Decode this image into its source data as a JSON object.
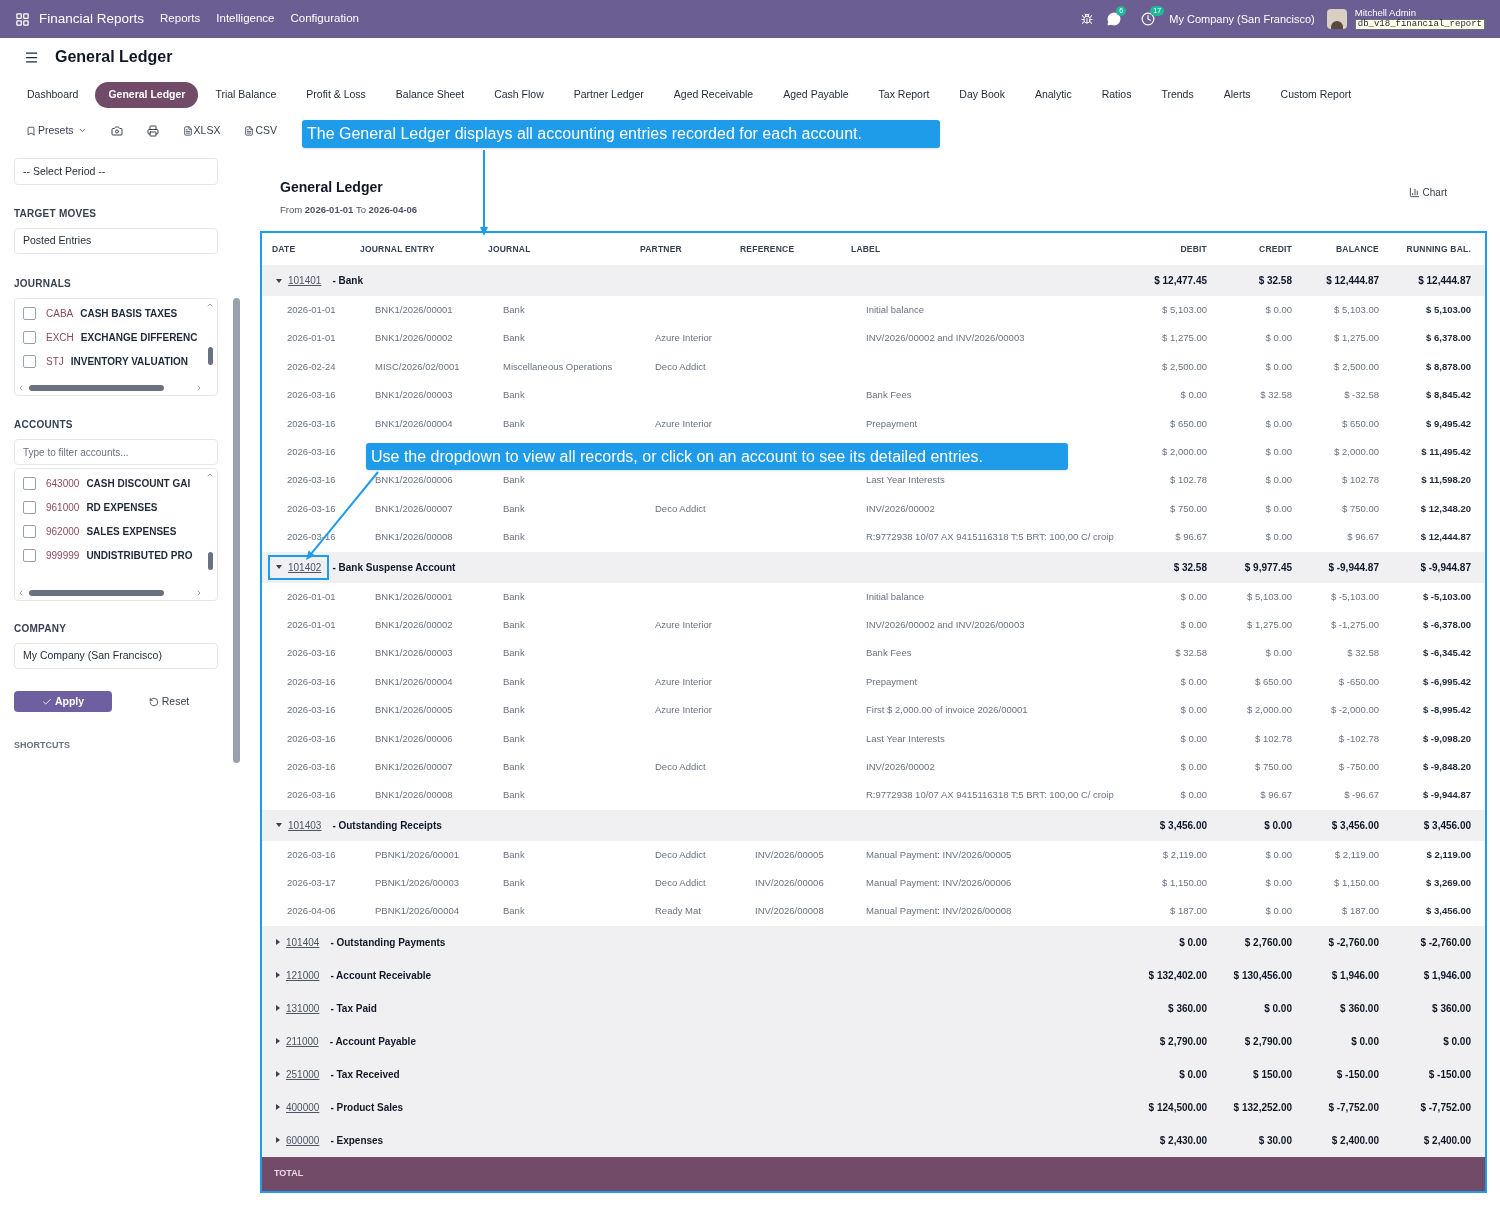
{
  "app": {
    "title": "Financial Reports",
    "menu": [
      "Reports",
      "Intelligence",
      "Configuration"
    ]
  },
  "systray": {
    "messages_badge": "6",
    "activities_badge": "17",
    "company": "My Company (San Francisco)",
    "user": "Mitchell Admin",
    "database": "db_v18_financial_report"
  },
  "page_title": "General Ledger",
  "tabs": [
    {
      "label": "Dashboard",
      "selected": false
    },
    {
      "label": "General Ledger",
      "selected": true
    },
    {
      "label": "Trial Balance",
      "selected": false
    },
    {
      "label": "Profit & Loss",
      "selected": false
    },
    {
      "label": "Balance Sheet",
      "selected": false
    },
    {
      "label": "Cash Flow",
      "selected": false
    },
    {
      "label": "Partner Ledger",
      "selected": false
    },
    {
      "label": "Aged Receivable",
      "selected": false
    },
    {
      "label": "Aged Payable",
      "selected": false
    },
    {
      "label": "Tax Report",
      "selected": false
    },
    {
      "label": "Day Book",
      "selected": false
    },
    {
      "label": "Analytic",
      "selected": false
    },
    {
      "label": "Ratios",
      "selected": false
    },
    {
      "label": "Trends",
      "selected": false
    },
    {
      "label": "Alerts",
      "selected": false
    },
    {
      "label": "Custom Report",
      "selected": false
    }
  ],
  "toolbar": {
    "presets": "Presets",
    "exports": [
      "XLSX",
      "CSV"
    ]
  },
  "sidebar": {
    "period": "-- Select Period --",
    "target_moves_label": "TARGET MOVES",
    "target_moves": "Posted Entries",
    "journals_label": "JOURNALS",
    "journals": [
      {
        "code": "CABA",
        "name": "CASH BASIS TAXES",
        "checked": false
      },
      {
        "code": "EXCH",
        "name": "EXCHANGE DIFFERENC",
        "checked": false
      },
      {
        "code": "STJ",
        "name": "INVENTORY VALUATION",
        "checked": false
      }
    ],
    "accounts_label": "ACCOUNTS",
    "accounts_placeholder": "Type to filter accounts...",
    "accounts": [
      {
        "code": "643000",
        "name": "CASH DISCOUNT GAI",
        "checked": false
      },
      {
        "code": "961000",
        "name": "RD EXPENSES",
        "checked": false
      },
      {
        "code": "962000",
        "name": "SALES EXPENSES",
        "checked": false
      },
      {
        "code": "999999",
        "name": "UNDISTRIBUTED PRO",
        "checked": false
      }
    ],
    "company_label": "COMPANY",
    "company": "My Company (San Francisco)",
    "apply": "Apply",
    "reset": "Reset",
    "shortcuts_label": "SHORTCUTS"
  },
  "report": {
    "title": "General Ledger",
    "period": "From **2026-01-01** To **2026-04-06**",
    "chart_button": "Chart",
    "columns": [
      "DATE",
      "JOURNAL ENTRY",
      "JOURNAL",
      "PARTNER",
      "REFERENCE",
      "LABEL",
      "DEBIT",
      "CREDIT",
      "BALANCE",
      "RUNNING BAL."
    ],
    "groups": [
      {
        "code": "101401",
        "name": "- Bank",
        "expanded": true,
        "highlighted": false,
        "debit": "$ 12,477.45",
        "credit": "$ 32.58",
        "balance": "$ 12,444.87",
        "running": "$ 12,444.87",
        "lines": [
          {
            "date": "2026-01-01",
            "entry": "BNK1/2026/00001",
            "journal": "Bank",
            "label": "Initial balance",
            "debit": "$ 5,103.00",
            "credit": "$ 0.00",
            "balance": "$ 5,103.00",
            "running": "$ 5,103.00"
          },
          {
            "date": "2026-01-01",
            "entry": "BNK1/2026/00002",
            "journal": "Bank",
            "partner": "Azure Interior",
            "label": "INV/2026/00002 and INV/2026/00003",
            "debit": "$ 1,275.00",
            "credit": "$ 0.00",
            "balance": "$ 1,275.00",
            "running": "$ 6,378.00"
          },
          {
            "date": "2026-02-24",
            "entry": "MISC/2026/02/0001",
            "journal": "Miscellaneous Operations",
            "partner": "Deco Addict",
            "debit": "$ 2,500.00",
            "credit": "$ 0.00",
            "balance": "$ 2,500.00",
            "running": "$ 8,878.00"
          },
          {
            "date": "2026-03-16",
            "entry": "BNK1/2026/00003",
            "journal": "Bank",
            "label": "Bank Fees",
            "debit": "$ 0.00",
            "credit": "$ 32.58",
            "balance": "$ -32.58",
            "running": "$ 8,845.42"
          },
          {
            "date": "2026-03-16",
            "entry": "BNK1/2026/00004",
            "journal": "Bank",
            "partner": "Azure Interior",
            "label": "Prepayment",
            "debit": "$ 650.00",
            "credit": "$ 0.00",
            "balance": "$ 650.00",
            "running": "$ 9,495.42"
          },
          {
            "date": "2026-03-16",
            "debit": "$ 2,000.00",
            "credit": "$ 0.00",
            "balance": "$ 2,000.00",
            "running": "$ 11,495.42"
          },
          {
            "date": "2026-03-16",
            "entry": "BNK1/2026/00006",
            "journal": "Bank",
            "label": "Last Year Interests",
            "debit": "$ 102.78",
            "credit": "$ 0.00",
            "balance": "$ 102.78",
            "running": "$ 11,598.20"
          },
          {
            "date": "2026-03-16",
            "entry": "BNK1/2026/00007",
            "journal": "Bank",
            "partner": "Deco Addict",
            "label": "INV/2026/00002",
            "debit": "$ 750.00",
            "credit": "$ 0.00",
            "balance": "$ 750.00",
            "running": "$ 12,348.20"
          },
          {
            "date": "2026-03-16",
            "entry": "BNK1/2026/00008",
            "journal": "Bank",
            "label": "R:9772938 10/07 AX 9415116318 T:5 BRT: 100,00 C/ croip",
            "debit": "$ 96.67",
            "credit": "$ 0.00",
            "balance": "$ 96.67",
            "running": "$ 12,444.87"
          }
        ]
      },
      {
        "code": "101402",
        "name": "- Bank Suspense Account",
        "expanded": true,
        "highlighted": true,
        "debit": "$ 32.58",
        "credit": "$ 9,977.45",
        "balance": "$ -9,944.87",
        "running": "$ -9,944.87",
        "lines": [
          {
            "date": "2026-01-01",
            "entry": "BNK1/2026/00001",
            "journal": "Bank",
            "label": "Initial balance",
            "debit": "$ 0.00",
            "credit": "$ 5,103.00",
            "balance": "$ -5,103.00",
            "running": "$ -5,103.00"
          },
          {
            "date": "2026-01-01",
            "entry": "BNK1/2026/00002",
            "journal": "Bank",
            "partner": "Azure Interior",
            "label": "INV/2026/00002 and INV/2026/00003",
            "debit": "$ 0.00",
            "credit": "$ 1,275.00",
            "balance": "$ -1,275.00",
            "running": "$ -6,378.00"
          },
          {
            "date": "2026-03-16",
            "entry": "BNK1/2026/00003",
            "journal": "Bank",
            "label": "Bank Fees",
            "debit": "$ 32.58",
            "credit": "$ 0.00",
            "balance": "$ 32.58",
            "running": "$ -6,345.42"
          },
          {
            "date": "2026-03-16",
            "entry": "BNK1/2026/00004",
            "journal": "Bank",
            "partner": "Azure Interior",
            "label": "Prepayment",
            "debit": "$ 0.00",
            "credit": "$ 650.00",
            "balance": "$ -650.00",
            "running": "$ -6,995.42"
          },
          {
            "date": "2026-03-16",
            "entry": "BNK1/2026/00005",
            "journal": "Bank",
            "partner": "Azure Interior",
            "label": "First $ 2,000.00 of invoice 2026/00001",
            "debit": "$ 0.00",
            "credit": "$ 2,000.00",
            "balance": "$ -2,000.00",
            "running": "$ -8,995.42"
          },
          {
            "date": "2026-03-16",
            "entry": "BNK1/2026/00006",
            "journal": "Bank",
            "label": "Last Year Interests",
            "debit": "$ 0.00",
            "credit": "$ 102.78",
            "balance": "$ -102.78",
            "running": "$ -9,098.20"
          },
          {
            "date": "2026-03-16",
            "entry": "BNK1/2026/00007",
            "journal": "Bank",
            "partner": "Deco Addict",
            "label": "INV/2026/00002",
            "debit": "$ 0.00",
            "credit": "$ 750.00",
            "balance": "$ -750.00",
            "running": "$ -9,848.20"
          },
          {
            "date": "2026-03-16",
            "entry": "BNK1/2026/00008",
            "journal": "Bank",
            "label": "R:9772938 10/07 AX 9415116318 T:5 BRT: 100,00 C/ croip",
            "debit": "$ 0.00",
            "credit": "$ 96.67",
            "balance": "$ -96.67",
            "running": "$ -9,944.87"
          }
        ]
      },
      {
        "code": "101403",
        "name": "- Outstanding Receipts",
        "expanded": true,
        "highlighted": false,
        "debit": "$ 3,456.00",
        "credit": "$ 0.00",
        "balance": "$ 3,456.00",
        "running": "$ 3,456.00",
        "lines": [
          {
            "date": "2026-03-16",
            "entry": "PBNK1/2026/00001",
            "journal": "Bank",
            "partner": "Deco Addict",
            "reference": "INV/2026/00005",
            "label": "Manual Payment: INV/2026/00005",
            "debit": "$ 2,119.00",
            "credit": "$ 0.00",
            "balance": "$ 2,119.00",
            "running": "$ 2,119.00"
          },
          {
            "date": "2026-03-17",
            "entry": "PBNK1/2026/00003",
            "journal": "Bank",
            "partner": "Deco Addict",
            "reference": "INV/2026/00006",
            "label": "Manual Payment: INV/2026/00006",
            "debit": "$ 1,150.00",
            "credit": "$ 0.00",
            "balance": "$ 1,150.00",
            "running": "$ 3,269.00"
          },
          {
            "date": "2026-04-06",
            "entry": "PBNK1/2026/00004",
            "journal": "Bank",
            "partner": "Ready Mat",
            "reference": "INV/2026/00008",
            "label": "Manual Payment: INV/2026/00008",
            "debit": "$ 187.00",
            "credit": "$ 0.00",
            "balance": "$ 187.00",
            "running": "$ 3,456.00"
          }
        ]
      },
      {
        "code": "101404",
        "name": "- Outstanding Payments",
        "expanded": false,
        "highlighted": false,
        "debit": "$ 0.00",
        "credit": "$ 2,760.00",
        "balance": "$ -2,760.00",
        "running": "$ -2,760.00"
      },
      {
        "code": "121000",
        "name": "- Account Receivable",
        "expanded": false,
        "highlighted": false,
        "debit": "$ 132,402.00",
        "credit": "$ 130,456.00",
        "balance": "$ 1,946.00",
        "running": "$ 1,946.00"
      },
      {
        "code": "131000",
        "name": "- Tax Paid",
        "expanded": false,
        "highlighted": false,
        "debit": "$ 360.00",
        "credit": "$ 0.00",
        "balance": "$ 360.00",
        "running": "$ 360.00"
      },
      {
        "code": "211000",
        "name": "- Account Payable",
        "expanded": false,
        "highlighted": false,
        "debit": "$ 2,790.00",
        "credit": "$ 2,790.00",
        "balance": "$ 0.00",
        "running": "$ 0.00"
      },
      {
        "code": "251000",
        "name": "- Tax Received",
        "expanded": false,
        "highlighted": false,
        "debit": "$ 0.00",
        "credit": "$ 150.00",
        "balance": "$ -150.00",
        "running": "$ -150.00"
      },
      {
        "code": "400000",
        "name": "- Product Sales",
        "expanded": false,
        "highlighted": false,
        "debit": "$ 124,500.00",
        "credit": "$ 132,252.00",
        "balance": "$ -7,752.00",
        "running": "$ -7,752.00"
      },
      {
        "code": "600000",
        "name": "- Expenses",
        "expanded": false,
        "highlighted": false,
        "debit": "$ 2,430.00",
        "credit": "$ 30.00",
        "balance": "$ 2,400.00",
        "running": "$ 2,400.00"
      }
    ],
    "total_label": "TOTAL"
  },
  "callouts": [
    "The General Ledger displays all accounting entries recorded for each account.",
    "Use the dropdown to view all records, or click on an account to see its detailed entries."
  ]
}
